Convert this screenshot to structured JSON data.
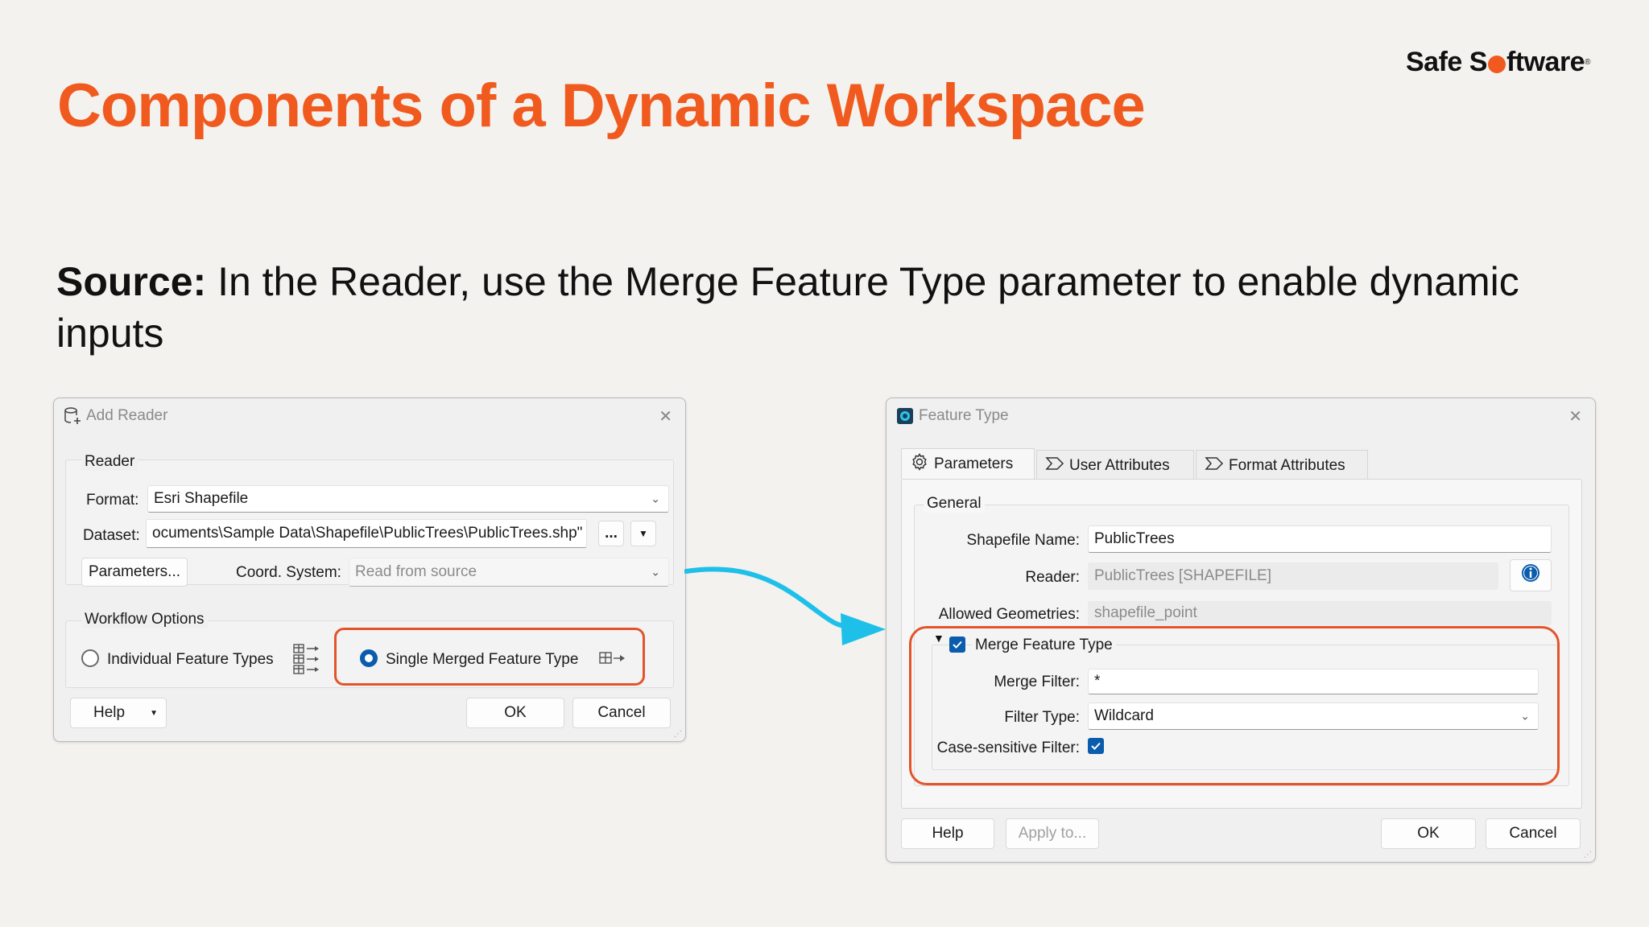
{
  "slide": {
    "title": "Components of a Dynamic Workspace",
    "logo_before": "Safe S",
    "logo_after": "ftware",
    "subtitle_bold": "Source:",
    "subtitle_rest": " In the Reader, use the Merge Feature Type parameter to enable dynamic inputs"
  },
  "add_reader": {
    "title": "Add Reader",
    "reader_group": "Reader",
    "format_label": "Format:",
    "format_value": "Esri Shapefile",
    "dataset_label": "Dataset:",
    "dataset_value": "ocuments\\Sample Data\\Shapefile\\PublicTrees\\PublicTrees.shp\"",
    "browse_label": "...",
    "parameters_button": "Parameters...",
    "coord_label": "Coord. System:",
    "coord_value": "Read from source",
    "workflow_group": "Workflow Options",
    "option_individual": "Individual Feature Types",
    "option_single": "Single Merged Feature Type",
    "selected_option": "Single Merged Feature Type",
    "help_button": "Help",
    "ok_button": "OK",
    "cancel_button": "Cancel"
  },
  "feature_type": {
    "title": "Feature Type",
    "tabs": [
      {
        "label": "Parameters",
        "icon": "gear-icon"
      },
      {
        "label": "User Attributes",
        "icon": "attribute-icon"
      },
      {
        "label": "Format Attributes",
        "icon": "attribute-icon"
      }
    ],
    "active_tab": "Parameters",
    "general_group": "General",
    "shapefile_name_label": "Shapefile Name:",
    "shapefile_name_value": "PublicTrees",
    "reader_label": "Reader:",
    "reader_value": "PublicTrees [SHAPEFILE]",
    "allowed_geom_label": "Allowed Geometries:",
    "allowed_geom_value": "shapefile_point",
    "merge_label": "Merge Feature Type",
    "merge_checked": true,
    "merge_filter_label": "Merge Filter:",
    "merge_filter_value": "*",
    "filter_type_label": "Filter Type:",
    "filter_type_value": "Wildcard",
    "case_label": "Case-sensitive Filter:",
    "case_checked": true,
    "help_button": "Help",
    "apply_button": "Apply to...",
    "ok_button": "OK",
    "cancel_button": "Cancel"
  },
  "colors": {
    "accent_orange": "#f05a1f",
    "highlight_orange": "#e3542a",
    "arrow_cyan": "#1ec0ea",
    "check_blue": "#0b5cad"
  }
}
